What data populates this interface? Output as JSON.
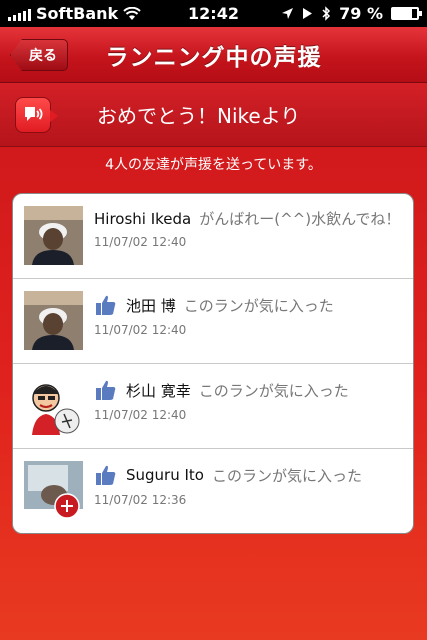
{
  "status_bar": {
    "carrier": "SoftBank",
    "time": "12:42",
    "battery": "79 %",
    "battery_level": 0.79
  },
  "nav": {
    "back_label": "戻る",
    "title": "ランニング中の声援"
  },
  "banner": {
    "title": "おめでとう！Nikeより"
  },
  "subtitle": "4人の友達が声援を送っています。",
  "cheers": [
    {
      "name": "Hiroshi Ikeda",
      "message": "がんばれー(^^)水飲んでね！",
      "timestamp": "11/07/02  12:40",
      "liked": false
    },
    {
      "name": "池田 博",
      "message": "このランが気に入った",
      "timestamp": "11/07/02  12:40",
      "liked": true
    },
    {
      "name": "杉山 寛幸",
      "message": "このランが気に入った",
      "timestamp": "11/07/02  12:40",
      "liked": true
    },
    {
      "name": "Suguru Ito",
      "message": "このランが気に入った",
      "timestamp": "11/07/02  12:36",
      "liked": true
    }
  ],
  "colors": {
    "accent": "#d42027",
    "like_blue": "#5b7bc0"
  }
}
